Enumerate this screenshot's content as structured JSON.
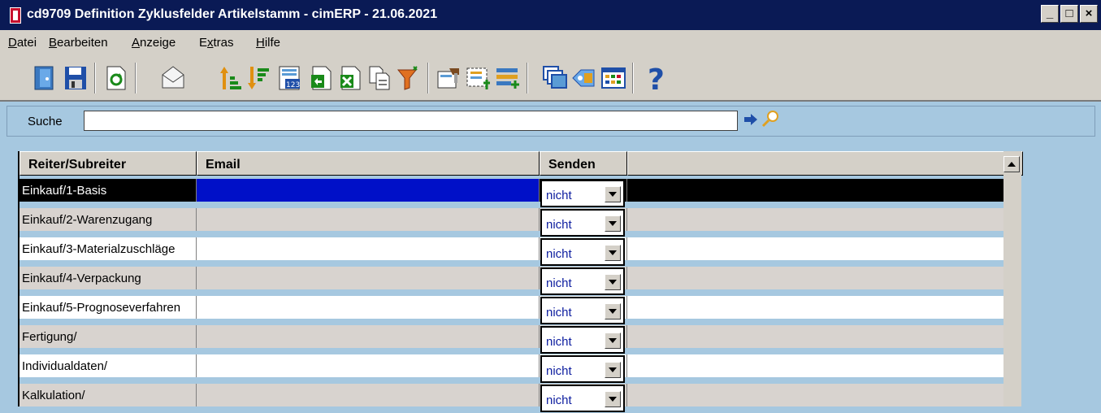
{
  "window": {
    "title": "cd9709 Definition Zyklusfelder Artikelstamm - cimERP - 21.06.2021"
  },
  "menu": [
    {
      "pre": "",
      "u": "D",
      "post": "atei"
    },
    {
      "pre": "",
      "u": "B",
      "post": "earbeiten"
    },
    {
      "pre": "",
      "u": "A",
      "post": "nzeige"
    },
    {
      "pre": "E",
      "u": "x",
      "post": "tras"
    },
    {
      "pre": "",
      "u": "H",
      "post": "ilfe"
    }
  ],
  "search": {
    "label": "Suche",
    "value": ""
  },
  "grid": {
    "headers": [
      "Reiter/Subreiter",
      "Email",
      "Senden",
      ""
    ],
    "rows": [
      {
        "reiter": "Einkauf/1-Basis",
        "email": "",
        "senden": "nicht"
      },
      {
        "reiter": "Einkauf/2-Warenzugang",
        "email": "",
        "senden": "nicht"
      },
      {
        "reiter": "Einkauf/3-Materialzuschläge",
        "email": "",
        "senden": "nicht"
      },
      {
        "reiter": "Einkauf/4-Verpackung",
        "email": "",
        "senden": "nicht"
      },
      {
        "reiter": "Einkauf/5-Prognoseverfahren",
        "email": "",
        "senden": "nicht"
      },
      {
        "reiter": "Fertigung/",
        "email": "",
        "senden": "nicht"
      },
      {
        "reiter": "Individualdaten/",
        "email": "",
        "senden": "nicht"
      },
      {
        "reiter": "Kalkulation/",
        "email": "",
        "senden": "nicht"
      }
    ]
  },
  "colors": {
    "selected_row": "#000000",
    "selected_email": "#0010c8",
    "row_white": "#ffffff",
    "row_gray": "#d8d3cf",
    "background": "#a6c8e0"
  }
}
